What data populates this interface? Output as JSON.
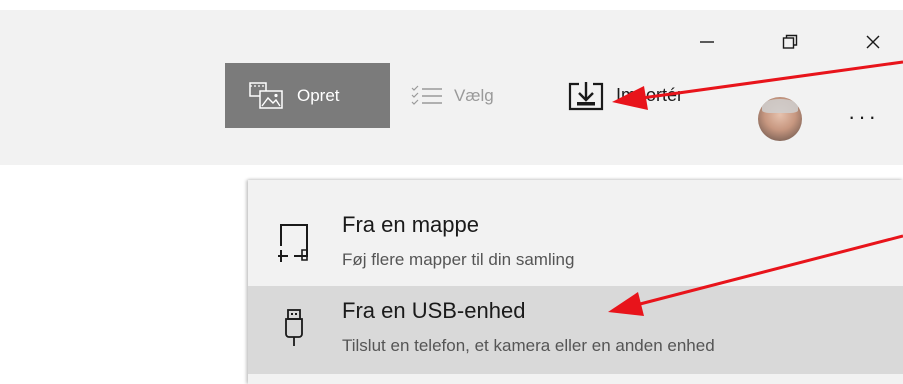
{
  "toolbar": {
    "create_label": "Opret",
    "select_label": "Vælg",
    "import_label": "Importér"
  },
  "window_controls": {
    "minimize": "minimize-icon",
    "maximize": "restore-icon",
    "close": "close-icon"
  },
  "import_menu": {
    "items": [
      {
        "title": "Fra en mappe",
        "subtitle": "Føj flere mapper til din samling",
        "icon": "folder-add-icon"
      },
      {
        "title": "Fra en USB-enhed",
        "subtitle": "Tilslut en telefon, et kamera eller en anden enhed",
        "icon": "usb-icon",
        "highlighted": true
      }
    ]
  },
  "colors": {
    "titlebar_bg": "#f2f2f2",
    "create_bg": "#7b7b7b",
    "highlight_bg": "#d9d9d9",
    "annotation_arrow": "#e8141b"
  }
}
